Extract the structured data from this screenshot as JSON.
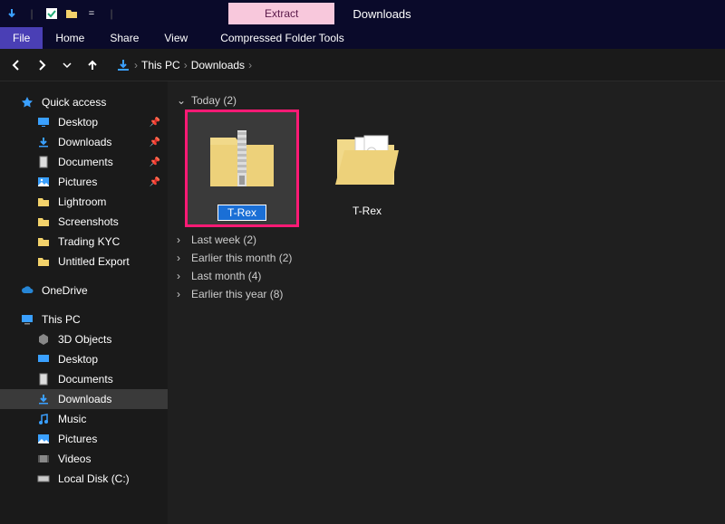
{
  "titlebar": {
    "contextual_tab_label": "Extract",
    "window_title": "Downloads"
  },
  "ribbon": {
    "file": "File",
    "home": "Home",
    "share": "Share",
    "view": "View",
    "tools": "Compressed Folder Tools"
  },
  "breadcrumb": {
    "root": "This PC",
    "current": "Downloads"
  },
  "sidebar": {
    "quick_access": "Quick access",
    "qa_items": [
      {
        "label": "Desktop",
        "pinned": true
      },
      {
        "label": "Downloads",
        "pinned": true
      },
      {
        "label": "Documents",
        "pinned": true
      },
      {
        "label": "Pictures",
        "pinned": true
      },
      {
        "label": "Lightroom",
        "pinned": false
      },
      {
        "label": "Screenshots",
        "pinned": false
      },
      {
        "label": "Trading KYC",
        "pinned": false
      },
      {
        "label": "Untitled Export",
        "pinned": false
      }
    ],
    "onedrive": "OneDrive",
    "this_pc": "This PC",
    "pc_items": [
      {
        "label": "3D Objects"
      },
      {
        "label": "Desktop"
      },
      {
        "label": "Documents"
      },
      {
        "label": "Downloads"
      },
      {
        "label": "Music"
      },
      {
        "label": "Pictures"
      },
      {
        "label": "Videos"
      },
      {
        "label": "Local Disk (C:)"
      }
    ]
  },
  "content": {
    "groups": [
      {
        "label": "Today (2)",
        "expanded": true
      },
      {
        "label": "Last week (2)",
        "expanded": false
      },
      {
        "label": "Earlier this month (2)",
        "expanded": false
      },
      {
        "label": "Last month (4)",
        "expanded": false
      },
      {
        "label": "Earlier this year (8)",
        "expanded": false
      }
    ],
    "items": [
      {
        "name": "T-Rex",
        "type": "zip",
        "selected": true,
        "editing": true
      },
      {
        "name": "T-Rex",
        "type": "folder",
        "selected": false,
        "editing": false
      }
    ]
  }
}
